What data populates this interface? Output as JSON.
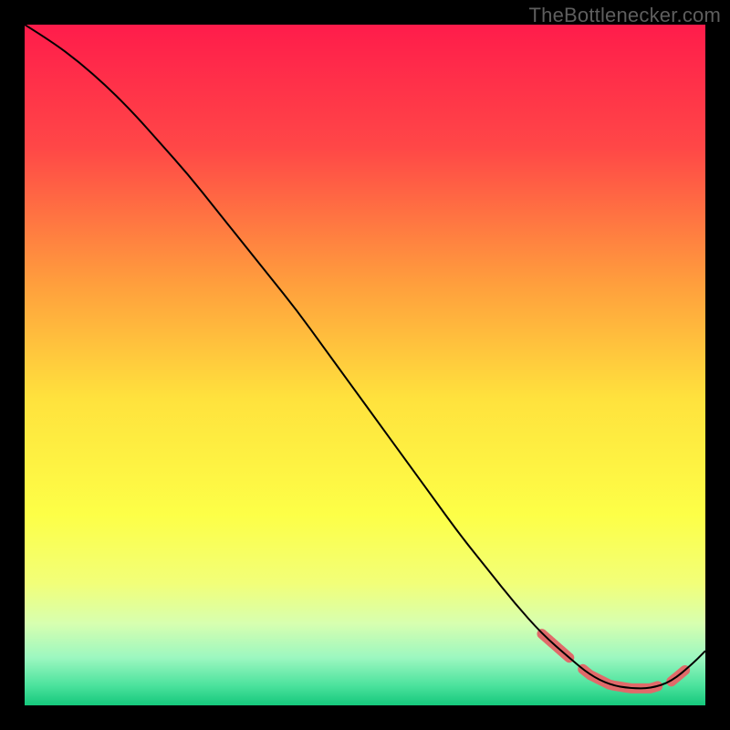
{
  "attribution": "TheBottlenecker.com",
  "chart_data": {
    "type": "line",
    "title": "",
    "xlabel": "",
    "ylabel": "",
    "xlim": [
      0,
      100
    ],
    "ylim": [
      0,
      100
    ],
    "series": [
      {
        "name": "curve",
        "x": [
          0,
          4,
          8,
          12,
          16,
          20,
          24,
          28,
          32,
          36,
          40,
          44,
          48,
          52,
          56,
          60,
          64,
          68,
          72,
          76,
          80,
          83,
          86,
          89,
          92,
          95,
          98,
          100
        ],
        "y": [
          100,
          97.5,
          94.5,
          91,
          87,
          82.5,
          78,
          73,
          68,
          63,
          58,
          52.5,
          47,
          41.5,
          36,
          30.5,
          25,
          20,
          15,
          10.5,
          7,
          4.5,
          3,
          2.5,
          2.5,
          3.5,
          6,
          8
        ]
      }
    ],
    "highlighted_ranges": [
      {
        "x_start": 76,
        "x_end": 80
      },
      {
        "x_start": 82,
        "x_end": 93
      },
      {
        "x_start": 95,
        "x_end": 97
      }
    ],
    "background_gradient": {
      "stops": [
        {
          "offset": 0.0,
          "color": "#ff1c4b"
        },
        {
          "offset": 0.18,
          "color": "#ff4747"
        },
        {
          "offset": 0.38,
          "color": "#ff9e3d"
        },
        {
          "offset": 0.55,
          "color": "#ffe23d"
        },
        {
          "offset": 0.72,
          "color": "#fdff47"
        },
        {
          "offset": 0.82,
          "color": "#f2ff78"
        },
        {
          "offset": 0.88,
          "color": "#d7ffb0"
        },
        {
          "offset": 0.93,
          "color": "#9cf7c0"
        },
        {
          "offset": 0.97,
          "color": "#4de39e"
        },
        {
          "offset": 1.0,
          "color": "#15c87c"
        }
      ]
    },
    "colors": {
      "curve": "#000000",
      "highlight": "#e06a6a"
    }
  }
}
